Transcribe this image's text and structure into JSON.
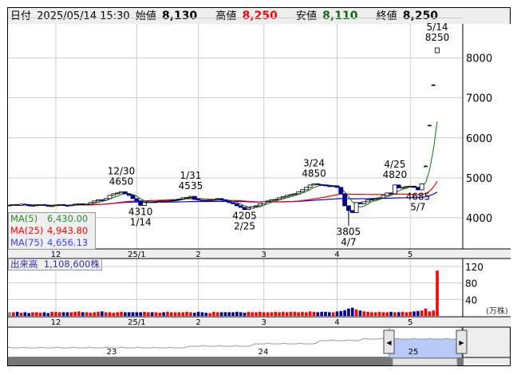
{
  "header": {
    "date_label": "日付",
    "date": "2025/05/14 15:30",
    "open_label": "始値",
    "open": "8,130",
    "high_label": "高値",
    "high": "8,250",
    "low_label": "安値",
    "low": "8,110",
    "close_label": "終値",
    "close": "8,250"
  },
  "colors": {
    "up": "#ff0000",
    "down": "#00008b",
    "flat": "#888888",
    "ma5": "#2e8b2e",
    "ma25": "#ff0000",
    "ma75": "#0000ff",
    "high_val": "#ff0000",
    "low_val": "#0a6a0a"
  },
  "legend": {
    "ma5_label": "MA(5)",
    "ma5": "6,430.00",
    "ma25_label": "MA(25)",
    "ma25": "4,943.80",
    "ma75_label": "MA(75)",
    "ma75": "4,656.13"
  },
  "volume_legend": {
    "label": "出来高",
    "value": "1,108,600株"
  },
  "volume_unit": "(万株)",
  "navigator": {
    "year_labels": [
      "23",
      "24",
      "25"
    ]
  },
  "chart_data": {
    "type": "candlestick",
    "price_ticks": [
      4000,
      5000,
      6000,
      7000,
      8000
    ],
    "price_range": [
      3220,
      8850
    ],
    "volume_ticks": [
      40,
      80,
      120
    ],
    "volume_range": [
      0,
      120
    ],
    "x_ticks": [
      {
        "label": "12",
        "index": 12
      },
      {
        "label": "25/1",
        "index": 33
      },
      {
        "label": "2",
        "index": 49
      },
      {
        "label": "3",
        "index": 66
      },
      {
        "label": "4",
        "index": 85
      },
      {
        "label": "5",
        "index": 104
      }
    ],
    "closes": [
      4320,
      4330,
      4310,
      4340,
      4330,
      4300,
      4310,
      4320,
      4330,
      4310,
      4290,
      4300,
      4320,
      4330,
      4310,
      4300,
      4320,
      4340,
      4350,
      4330,
      4340,
      4380,
      4420,
      4450,
      4440,
      4480,
      4560,
      4600,
      4620,
      4650,
      4600,
      4560,
      4480,
      4420,
      4310,
      4380,
      4400,
      4390,
      4410,
      4420,
      4400,
      4420,
      4440,
      4450,
      4470,
      4500,
      4510,
      4535,
      4460,
      4440,
      4430,
      4420,
      4440,
      4460,
      4480,
      4450,
      4420,
      4380,
      4350,
      4300,
      4260,
      4205,
      4240,
      4280,
      4300,
      4350,
      4400,
      4420,
      4450,
      4460,
      4500,
      4530,
      4560,
      4580,
      4600,
      4650,
      4700,
      4760,
      4820,
      4850,
      4830,
      4820,
      4800,
      4780,
      4800,
      4760,
      4600,
      4300,
      4180,
      4130,
      4380,
      4350,
      4400,
      4450,
      4460,
      4480,
      4500,
      4560,
      4620,
      4600,
      4820,
      4750,
      4760,
      4780,
      4790,
      4760,
      4700,
      4850,
      5300,
      6320,
      7330,
      8250
    ],
    "last_open": 8130,
    "volumes": [
      9,
      9,
      10,
      8,
      9,
      7,
      9,
      9,
      8,
      9,
      7,
      10,
      10,
      9,
      9,
      9,
      9,
      10,
      11,
      9,
      9,
      8,
      9,
      10,
      11,
      9,
      9,
      8,
      9,
      10,
      9,
      9,
      9,
      9,
      9,
      10,
      9,
      9,
      9,
      8,
      9,
      10,
      9,
      9,
      9,
      9,
      10,
      9,
      8,
      10,
      9,
      8,
      7,
      10,
      9,
      9,
      9,
      9,
      9,
      10,
      9,
      8,
      10,
      9,
      9,
      10,
      9,
      9,
      9,
      10,
      9,
      10,
      9,
      10,
      10,
      9,
      10,
      9,
      11,
      10,
      9,
      10,
      10,
      9,
      9,
      11,
      12,
      14,
      18,
      20,
      16,
      13,
      11,
      10,
      9,
      9,
      10,
      9,
      9,
      10,
      9,
      9,
      10,
      9,
      10,
      11,
      12,
      13,
      18,
      11,
      13,
      110
    ],
    "annotations": [
      {
        "date": "12/30",
        "value": "4650",
        "index": 29,
        "pos": "above"
      },
      {
        "date": "1/14",
        "value": "4310",
        "index": 34,
        "pos": "below"
      },
      {
        "date": "1/31",
        "value": "4535",
        "index": 47,
        "pos": "above"
      },
      {
        "date": "2/25",
        "value": "4205",
        "index": 61,
        "pos": "below"
      },
      {
        "date": "3/24",
        "value": "4850",
        "index": 79,
        "pos": "above"
      },
      {
        "date": "4/7",
        "value": "3805",
        "index": 88,
        "pos": "below"
      },
      {
        "date": "4/25",
        "value": "4820",
        "index": 100,
        "pos": "above"
      },
      {
        "date": "5/7",
        "value": "4685",
        "index": 106,
        "pos": "below"
      },
      {
        "date": "5/14",
        "value": "8250",
        "index": 111,
        "pos": "above"
      }
    ]
  }
}
